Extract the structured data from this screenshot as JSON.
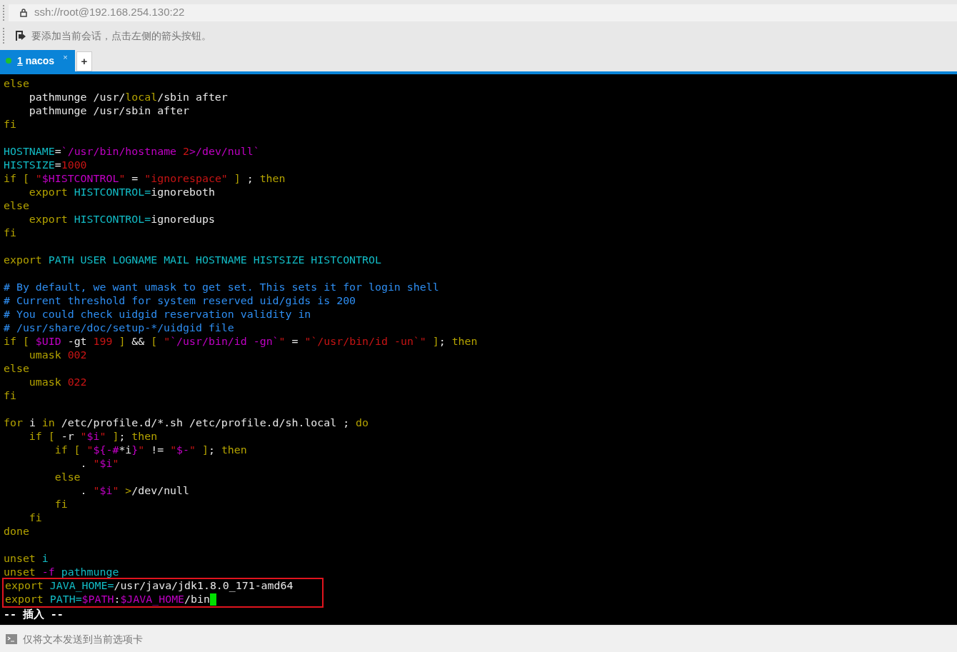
{
  "address_bar": {
    "text": "ssh://root@192.168.254.130:22"
  },
  "hint_bar": {
    "text": "要添加当前会话，点击左侧的箭头按钮。"
  },
  "tabs": [
    {
      "number": "1",
      "label": "nacos",
      "selected": true,
      "connected": true,
      "close": "×"
    }
  ],
  "new_tab": "+",
  "terminal": {
    "lines": [
      {
        "kind": "code",
        "segments": [
          {
            "text": "else",
            "kind": "keyword"
          }
        ]
      },
      {
        "kind": "code",
        "segments": [
          {
            "text": "    pathmunge /usr/",
            "kind": "plain"
          },
          {
            "text": "local",
            "kind": "keyword"
          },
          {
            "text": "/sbin after",
            "kind": "plain"
          }
        ]
      },
      {
        "kind": "code",
        "segments": [
          {
            "text": "    pathmunge /usr/sbin after",
            "kind": "plain"
          }
        ]
      },
      {
        "kind": "code",
        "segments": [
          {
            "text": "fi",
            "kind": "keyword"
          }
        ]
      },
      {
        "kind": "blank"
      },
      {
        "kind": "code",
        "segments": [
          {
            "text": "HOSTNAME",
            "kind": "variable"
          },
          {
            "text": "=",
            "kind": "plain"
          },
          {
            "text": "`/usr/bin/hostname ",
            "kind": "special"
          },
          {
            "text": "2",
            "kind": "string"
          },
          {
            "text": ">/dev/null`",
            "kind": "special"
          }
        ]
      },
      {
        "kind": "code",
        "segments": [
          {
            "text": "HISTSIZE",
            "kind": "variable"
          },
          {
            "text": "=",
            "kind": "plain"
          },
          {
            "text": "1000",
            "kind": "string"
          }
        ]
      },
      {
        "kind": "code",
        "segments": [
          {
            "text": "if [ ",
            "kind": "keyword"
          },
          {
            "text": "\"",
            "kind": "string"
          },
          {
            "text": "$HISTCONTROL",
            "kind": "special"
          },
          {
            "text": "\"",
            "kind": "string"
          },
          {
            "text": " = ",
            "kind": "plain"
          },
          {
            "text": "\"ignorespace\"",
            "kind": "string"
          },
          {
            "text": " ] ",
            "kind": "keyword"
          },
          {
            "text": "; ",
            "kind": "plain"
          },
          {
            "text": "then",
            "kind": "keyword"
          }
        ]
      },
      {
        "kind": "code",
        "segments": [
          {
            "text": "    export ",
            "kind": "keyword"
          },
          {
            "text": "HISTCONTROL",
            "kind": "variable"
          },
          {
            "text": "=",
            "kind": "variable"
          },
          {
            "text": "ignoreboth",
            "kind": "plain"
          }
        ]
      },
      {
        "kind": "code",
        "segments": [
          {
            "text": "else",
            "kind": "keyword"
          }
        ]
      },
      {
        "kind": "code",
        "segments": [
          {
            "text": "    export ",
            "kind": "keyword"
          },
          {
            "text": "HISTCONTROL",
            "kind": "variable"
          },
          {
            "text": "=",
            "kind": "variable"
          },
          {
            "text": "ignoredups",
            "kind": "plain"
          }
        ]
      },
      {
        "kind": "code",
        "segments": [
          {
            "text": "fi",
            "kind": "keyword"
          }
        ]
      },
      {
        "kind": "blank"
      },
      {
        "kind": "code",
        "segments": [
          {
            "text": "export ",
            "kind": "keyword"
          },
          {
            "text": "PATH USER LOGNAME MAIL HOSTNAME HISTSIZE HISTCONTROL",
            "kind": "variable"
          }
        ]
      },
      {
        "kind": "blank"
      },
      {
        "kind": "code",
        "segments": [
          {
            "text": "# By default, we want umask to get set. This sets it for login shell",
            "kind": "comment"
          }
        ]
      },
      {
        "kind": "code",
        "segments": [
          {
            "text": "# Current threshold for system reserved uid/gids is 200",
            "kind": "comment"
          }
        ]
      },
      {
        "kind": "code",
        "segments": [
          {
            "text": "# You could check uidgid reservation validity in",
            "kind": "comment"
          }
        ]
      },
      {
        "kind": "code",
        "segments": [
          {
            "text": "# /usr/share/doc/setup-*/uidgid file",
            "kind": "comment"
          }
        ]
      },
      {
        "kind": "code",
        "segments": [
          {
            "text": "if [ ",
            "kind": "keyword"
          },
          {
            "text": "$UID",
            "kind": "special"
          },
          {
            "text": " -gt ",
            "kind": "plain"
          },
          {
            "text": "199",
            "kind": "string"
          },
          {
            "text": " ] ",
            "kind": "keyword"
          },
          {
            "text": "&& ",
            "kind": "plain"
          },
          {
            "text": "[ ",
            "kind": "keyword"
          },
          {
            "text": "\"",
            "kind": "string"
          },
          {
            "text": "`/usr/bin/id -gn`",
            "kind": "special"
          },
          {
            "text": "\"",
            "kind": "string"
          },
          {
            "text": " = ",
            "kind": "plain"
          },
          {
            "text": "\"`/usr/bin/id -un`\"",
            "kind": "string"
          },
          {
            "text": " ]",
            "kind": "keyword"
          },
          {
            "text": "; ",
            "kind": "plain"
          },
          {
            "text": "then",
            "kind": "keyword"
          }
        ]
      },
      {
        "kind": "code",
        "segments": [
          {
            "text": "    umask ",
            "kind": "keyword"
          },
          {
            "text": "002",
            "kind": "string"
          }
        ]
      },
      {
        "kind": "code",
        "segments": [
          {
            "text": "else",
            "kind": "keyword"
          }
        ]
      },
      {
        "kind": "code",
        "segments": [
          {
            "text": "    umask ",
            "kind": "keyword"
          },
          {
            "text": "022",
            "kind": "string"
          }
        ]
      },
      {
        "kind": "code",
        "segments": [
          {
            "text": "fi",
            "kind": "keyword"
          }
        ]
      },
      {
        "kind": "blank"
      },
      {
        "kind": "code",
        "segments": [
          {
            "text": "for ",
            "kind": "keyword"
          },
          {
            "text": "i ",
            "kind": "plain"
          },
          {
            "text": "in ",
            "kind": "keyword"
          },
          {
            "text": "/etc/profile.d/*.sh /etc/profile.d/sh.local ; ",
            "kind": "plain"
          },
          {
            "text": "do",
            "kind": "keyword"
          }
        ]
      },
      {
        "kind": "code",
        "segments": [
          {
            "text": "    if [ ",
            "kind": "keyword"
          },
          {
            "text": "-r ",
            "kind": "plain"
          },
          {
            "text": "\"",
            "kind": "string"
          },
          {
            "text": "$i",
            "kind": "special"
          },
          {
            "text": "\"",
            "kind": "string"
          },
          {
            "text": " ]",
            "kind": "keyword"
          },
          {
            "text": "; ",
            "kind": "plain"
          },
          {
            "text": "then",
            "kind": "keyword"
          }
        ]
      },
      {
        "kind": "code",
        "segments": [
          {
            "text": "        if [ ",
            "kind": "keyword"
          },
          {
            "text": "\"",
            "kind": "string"
          },
          {
            "text": "${-#",
            "kind": "special"
          },
          {
            "text": "*i",
            "kind": "plain"
          },
          {
            "text": "}",
            "kind": "special"
          },
          {
            "text": "\"",
            "kind": "string"
          },
          {
            "text": " != ",
            "kind": "plain"
          },
          {
            "text": "\"",
            "kind": "string"
          },
          {
            "text": "$-",
            "kind": "special"
          },
          {
            "text": "\"",
            "kind": "string"
          },
          {
            "text": " ]",
            "kind": "keyword"
          },
          {
            "text": "; ",
            "kind": "plain"
          },
          {
            "text": "then",
            "kind": "keyword"
          }
        ]
      },
      {
        "kind": "code",
        "segments": [
          {
            "text": "            . ",
            "kind": "plain"
          },
          {
            "text": "\"",
            "kind": "string"
          },
          {
            "text": "$i",
            "kind": "special"
          },
          {
            "text": "\"",
            "kind": "string"
          }
        ]
      },
      {
        "kind": "code",
        "segments": [
          {
            "text": "        else",
            "kind": "keyword"
          }
        ]
      },
      {
        "kind": "code",
        "segments": [
          {
            "text": "            . ",
            "kind": "plain"
          },
          {
            "text": "\"",
            "kind": "string"
          },
          {
            "text": "$i",
            "kind": "special"
          },
          {
            "text": "\"",
            "kind": "string"
          },
          {
            "text": " >",
            "kind": "keyword"
          },
          {
            "text": "/dev/null",
            "kind": "plain"
          }
        ]
      },
      {
        "kind": "code",
        "segments": [
          {
            "text": "        fi",
            "kind": "keyword"
          }
        ]
      },
      {
        "kind": "code",
        "segments": [
          {
            "text": "    fi",
            "kind": "keyword"
          }
        ]
      },
      {
        "kind": "code",
        "segments": [
          {
            "text": "done",
            "kind": "keyword"
          }
        ]
      },
      {
        "kind": "blank"
      },
      {
        "kind": "code",
        "segments": [
          {
            "text": "unset ",
            "kind": "keyword"
          },
          {
            "text": "i",
            "kind": "variable"
          }
        ]
      },
      {
        "kind": "code",
        "segments": [
          {
            "text": "unset ",
            "kind": "keyword"
          },
          {
            "text": "-f ",
            "kind": "special"
          },
          {
            "text": "pathmunge",
            "kind": "variable"
          }
        ]
      }
    ],
    "boxed_lines": [
      {
        "kind": "code",
        "segments": [
          {
            "text": "export ",
            "kind": "keyword"
          },
          {
            "text": "JAVA_HOME",
            "kind": "variable"
          },
          {
            "text": "=",
            "kind": "variable"
          },
          {
            "text": "/usr/java/jdk1.8.0_171-amd64",
            "kind": "plain"
          }
        ]
      },
      {
        "kind": "code",
        "cursor": true,
        "segments": [
          {
            "text": "export ",
            "kind": "keyword"
          },
          {
            "text": "PATH",
            "kind": "variable"
          },
          {
            "text": "=",
            "kind": "variable"
          },
          {
            "text": "$PATH",
            "kind": "special"
          },
          {
            "text": ":",
            "kind": "plain"
          },
          {
            "text": "$JAVA_HOME",
            "kind": "special"
          },
          {
            "text": "/bin",
            "kind": "plain"
          }
        ]
      }
    ],
    "mode_line": "-- 插入 --"
  },
  "send_bar": {
    "text": "仅将文本发送到当前选项卡"
  }
}
